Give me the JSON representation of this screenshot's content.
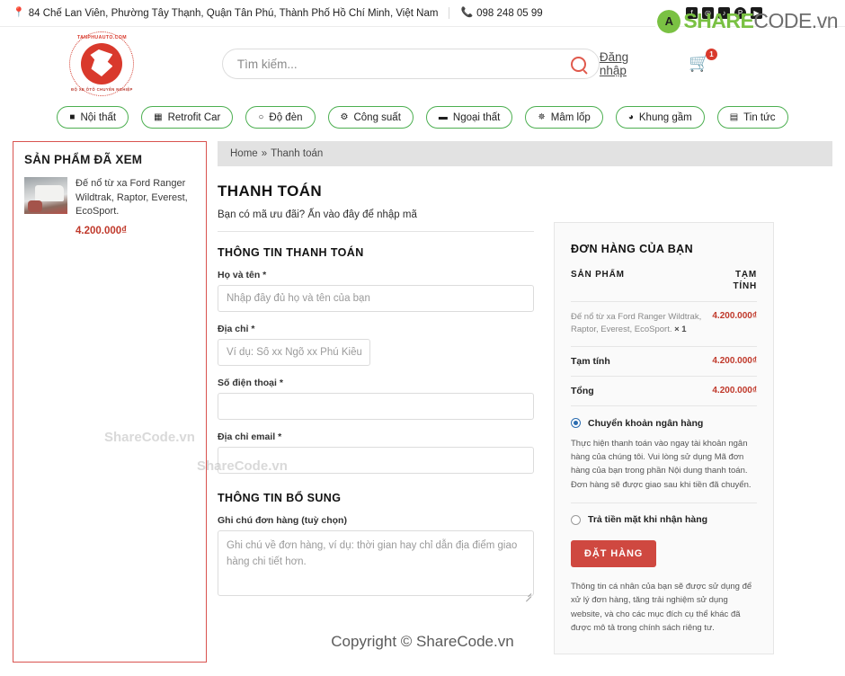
{
  "topbar": {
    "address": "84 Chế Lan Viên, Phường Tây Thạnh, Quận Tân Phú, Thành Phố Hồ Chí Minh, Việt Nam",
    "phone": "098 248 05 99",
    "location_icon": "map-pin-icon",
    "phone_icon": "phone-icon",
    "socials": [
      {
        "name": "facebook-icon",
        "glyph": "f"
      },
      {
        "name": "instagram-icon",
        "glyph": "◎"
      },
      {
        "name": "tiktok-icon",
        "glyph": "♪"
      },
      {
        "name": "pinterest-icon",
        "glyph": "P"
      },
      {
        "name": "youtube-icon",
        "glyph": "▶"
      }
    ]
  },
  "watermark": {
    "brand_green": "SHARE",
    "brand_dark": "CODE.vn",
    "mark_letter": "A",
    "overlay_1": "ShareCode.vn",
    "overlay_2": "ShareCode.vn",
    "footer": "Copyright © ShareCode.vn"
  },
  "header": {
    "logo_top": "TANPHUAUTO.COM",
    "logo_bottom": "ĐỘ XE ÔTÔ CHUYÊN NGHIỆP",
    "search_placeholder": "Tìm kiếm...",
    "search_value": "",
    "login_label": "Đăng nhập",
    "cart_count": "1"
  },
  "nav": {
    "items": [
      {
        "label": "Nội thất",
        "icon": "camera-icon",
        "glyph": "■"
      },
      {
        "label": "Retrofit Car",
        "icon": "chip-icon",
        "glyph": "▦"
      },
      {
        "label": "Độ đèn",
        "icon": "bulb-icon",
        "glyph": "○"
      },
      {
        "label": "Công suất",
        "icon": "gears-icon",
        "glyph": "⚙"
      },
      {
        "label": "Ngoại thất",
        "icon": "car-icon",
        "glyph": "▬"
      },
      {
        "label": "Mâm lốp",
        "icon": "wheel-icon",
        "glyph": "✵"
      },
      {
        "label": "Khung gầm",
        "icon": "chassis-icon",
        "glyph": "◕"
      },
      {
        "label": "Tin tức",
        "icon": "news-icon",
        "glyph": "▤"
      }
    ]
  },
  "sidebar": {
    "title": "SẢN PHẨM ĐÃ XEM",
    "product": {
      "thumb_icon": "product-thumbnail",
      "name": "Đế nổ từ xa Ford Ranger Wildtrak, Raptor, Everest, EcoSport.",
      "price": "4.200.000₫"
    }
  },
  "breadcrumb": {
    "home": "Home",
    "separator": "»",
    "current": "Thanh toán"
  },
  "checkout": {
    "title": "THANH TOÁN",
    "coupon_text": "Bạn có mã ưu đãi? Ấn vào đây để nhập mã",
    "billing_title": "THÔNG TIN THANH TOÁN",
    "fields": [
      {
        "label": "Họ và tên *",
        "placeholder": "Nhập đầy đủ họ và tên của bạn",
        "value": ""
      },
      {
        "label": "Địa chỉ *",
        "placeholder": "Ví dụ: Số xx Ngõ xx Phú Kiều, Bắ",
        "value": ""
      },
      {
        "label": "Số điện thoại *",
        "placeholder": "",
        "value": ""
      },
      {
        "label": "Địa chỉ email *",
        "placeholder": "",
        "value": ""
      }
    ],
    "extra_title": "THÔNG TIN BỔ SUNG",
    "notes_label": "Ghi chú đơn hàng (tuỳ chọn)",
    "notes_placeholder": "Ghi chú về đơn hàng, ví dụ: thời gian hay chỉ dẫn địa điểm giao hàng chi tiết hơn.",
    "notes_value": ""
  },
  "order": {
    "title": "ĐƠN HÀNG CỦA BẠN",
    "col_product": "SẢN PHẨM",
    "col_subtotal": "TẠM TÍNH",
    "item_name": "Đế nổ từ xa Ford Ranger Wildtrak, Raptor, Everest, EcoSport.",
    "item_qty": "× 1",
    "item_price": "4.200.000₫",
    "subtotal_label": "Tạm tính",
    "subtotal_value": "4.200.000₫",
    "total_label": "Tổng",
    "total_value": "4.200.000₫",
    "payment_bank_label": "Chuyển khoản ngân hàng",
    "payment_bank_desc": "Thực hiện thanh toán vào ngay tài khoản ngân hàng của chúng tôi. Vui lòng sử dụng Mã đơn hàng của bạn trong phần Nội dung thanh toán. Đơn hàng sẽ được giao sau khi tiền đã chuyển.",
    "payment_cod_label": "Trả tiền mặt khi nhận hàng",
    "submit_label": "ĐẶT HÀNG",
    "privacy": "Thông tin cá nhân của bạn sẽ được sử dụng để xử lý đơn hàng, tăng trải nghiệm sử dụng website, và cho các mục đích cụ thể khác đã được mô tả trong chính sách riêng tư."
  },
  "colors": {
    "brand_red": "#d9392c",
    "accent_green": "#4caf50",
    "price_red": "#c0392b",
    "button_red": "#cf4840",
    "radio_blue": "#2b6cb0"
  }
}
